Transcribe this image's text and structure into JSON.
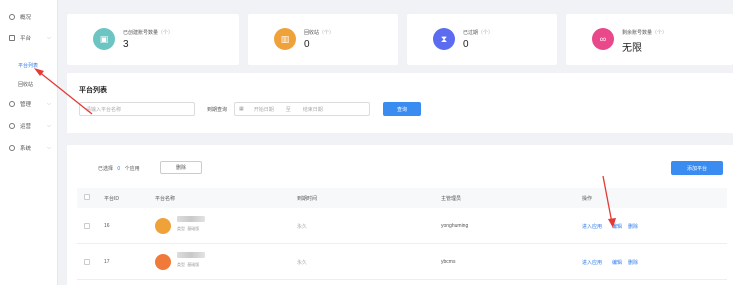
{
  "sidebar": {
    "items": [
      {
        "label": "概况",
        "has_children": false
      },
      {
        "label": "平台",
        "has_children": true
      },
      {
        "label": "管理",
        "has_children": true
      },
      {
        "label": "运营",
        "has_children": true
      },
      {
        "label": "系统",
        "has_children": true
      }
    ],
    "sub_items": [
      {
        "label": "平台列表",
        "active": true
      },
      {
        "label": "回收站",
        "active": false
      }
    ]
  },
  "stats": [
    {
      "label": "已创建账号数量",
      "unit": "（个）",
      "value": "3",
      "color": "#6cc5c2",
      "icon": "id-card-icon"
    },
    {
      "label": "回收站",
      "unit": "（个）",
      "value": "0",
      "color": "#f0a23a",
      "icon": "trash-icon"
    },
    {
      "label": "已过期",
      "unit": "（个）",
      "value": "0",
      "color": "#5b6cf0",
      "icon": "hourglass-icon"
    },
    {
      "label": "剩余账号数量",
      "unit": "（个）",
      "value": "无限",
      "color": "#e9488a",
      "icon": "link-icon"
    }
  ],
  "filter": {
    "title": "平台列表",
    "name_placeholder": "请输入平台名称",
    "date_label": "到期查询",
    "start_placeholder": "开始日期",
    "separator": "至",
    "end_placeholder": "结束日期",
    "search_button": "查询"
  },
  "list": {
    "selected_prefix": "已选择",
    "selected_count": "0",
    "selected_suffix": "个应用",
    "delete_button": "删除",
    "add_button": "添加平台",
    "columns": [
      "平台ID",
      "平台名称",
      "到期时间",
      "主管理员",
      "操作"
    ],
    "rows": [
      {
        "id": "16",
        "meta_type": "类型",
        "meta_value": "基础版",
        "expire": "永久",
        "admin": "yonghuming",
        "avatar_color": "#f0a23a"
      },
      {
        "id": "17",
        "meta_type": "类型",
        "meta_value": "基础版",
        "expire": "永久",
        "admin": "ybcms",
        "avatar_color": "#f07a3a"
      }
    ],
    "actions": [
      "进入应用",
      "编辑",
      "删除"
    ]
  }
}
